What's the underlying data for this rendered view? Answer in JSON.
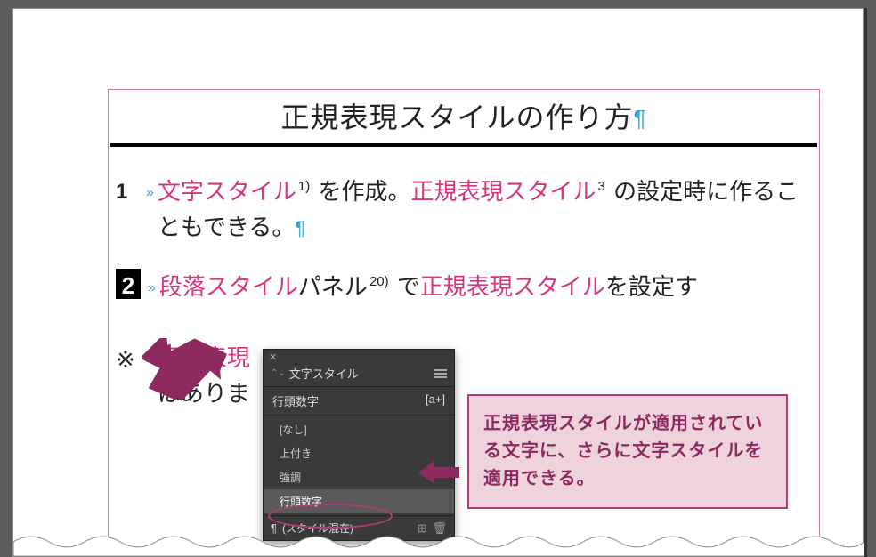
{
  "title": "正規表現スタイルの作り方",
  "pilcrow": "¶",
  "items": [
    {
      "num": "1",
      "raquo": "»",
      "text": {
        "seg1": "文字スタイル",
        "sup1": "1)",
        "seg2": " を作成。",
        "seg3": "正規表現スタイル",
        "sup2": "3",
        "seg4": " の設定時に作ることもできる。"
      }
    },
    {
      "num": "2",
      "raquo": "»",
      "text": {
        "seg1": "段落スタイル",
        "seg2": "パネル",
        "sup1": "20)",
        "seg3": " で",
        "seg4": "正規表現スタイル",
        "seg5": "を設定す"
      }
    },
    {
      "mark": "※",
      "raquo": "»",
      "text": {
        "seg1": "正規表現",
        "seg2": "はありま"
      }
    }
  ],
  "panel": {
    "close": "✕",
    "tab_name": "文字スタイル",
    "current_label": "行頭数字",
    "current_badge": "[a+]",
    "items": [
      {
        "label": "[なし]"
      },
      {
        "label": "上付き"
      },
      {
        "label": "強調"
      },
      {
        "label": "行頭数字",
        "selected": true
      }
    ],
    "footer": {
      "pilcrow": "¶",
      "mixed": "(スタイル混在)",
      "icon_new": "⊞",
      "icon_trash": "🗑"
    }
  },
  "annotation": "正規表現スタイルが適用されている文字に、さらに文字スタイルを適用できる。"
}
